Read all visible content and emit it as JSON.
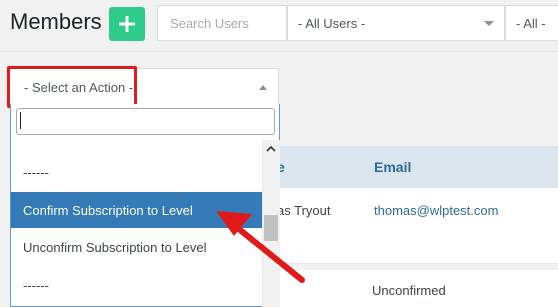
{
  "header": {
    "title": "Members",
    "add_button_icon": "plus-icon"
  },
  "search": {
    "placeholder": "Search Users"
  },
  "filters": {
    "users_selected": "- All Users -",
    "all_selected": "- All -"
  },
  "table": {
    "columns": [
      "e",
      "Email"
    ],
    "rows": [
      {
        "name": "as Tryout",
        "email": "thomas@wlptest.com"
      },
      {
        "status": "Unconfirmed"
      }
    ]
  },
  "actions": {
    "selected": "- Select an Action -",
    "options": [
      {
        "label": "------",
        "selected": false
      },
      {
        "label": "Confirm Subscription to Level",
        "selected": true
      },
      {
        "label": "Unconfirm Subscription to Level",
        "selected": false
      },
      {
        "label": "------",
        "selected": false
      }
    ]
  },
  "colors": {
    "accent_green": "#2ecc8a",
    "highlight_red": "#e01919",
    "selected_blue": "#337ab7",
    "link_blue": "#2d6c9b"
  }
}
